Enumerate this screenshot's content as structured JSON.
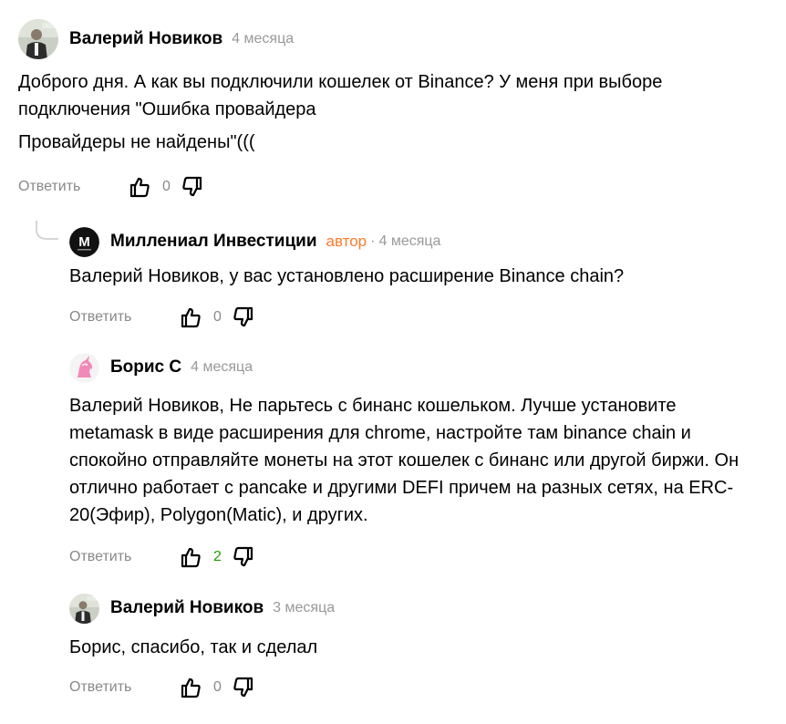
{
  "comments": [
    {
      "author": "Валерий Новиков",
      "time": "4 месяца",
      "text": [
        "Доброго дня. А как вы подключили кошелек от Binance? У меня при выборе подключения \"Ошибка провайдера",
        "Провайдеры не найдены\"((("
      ],
      "reply_label": "Ответить",
      "likes": "0",
      "avatar_icon": "person-photo"
    },
    {
      "author": "Миллениал Инвестиции",
      "badge": "автор",
      "separator": "·",
      "time": "4 месяца",
      "text": [
        "Валерий Новиков, у вас установлено расширение Binance chain?"
      ],
      "reply_label": "Ответить",
      "likes": "0",
      "avatar_letter": "M",
      "avatar_icon": "channel-logo"
    },
    {
      "author": "Борис С",
      "time": "4 месяца",
      "text": [
        "Валерий Новиков, Не парьтесь с бинанс кошельком. Лучше установите metamask в виде расширения для chrome, настройте там binance chain и спокойно отправляйте монеты на этот кошелек с бинанс или другой биржи. Он отлично работает с pancake и другими DEFI причем на разных сетях, на ERC-20(Эфир), Polygon(Matic), и других."
      ],
      "reply_label": "Ответить",
      "likes": "2",
      "avatar_icon": "pink-unicorn"
    },
    {
      "author": "Валерий Новиков",
      "time": "3 месяца",
      "text": [
        "Борис, спасибо, так и сделал"
      ],
      "reply_label": "Ответить",
      "likes": "0",
      "avatar_icon": "person-photo"
    }
  ],
  "colors": {
    "author_badge": "#ff7a2a",
    "positive_count": "#1fa000",
    "muted": "#999999"
  }
}
